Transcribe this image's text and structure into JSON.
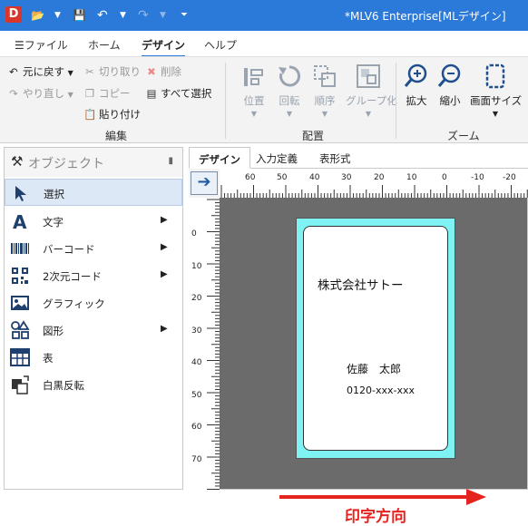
{
  "app": {
    "title": "*MLV6 Enterprise[MLデザイン]",
    "icon_letter": "D"
  },
  "ribbon_tabs": [
    {
      "label": "ファイル",
      "active": false
    },
    {
      "label": "ホーム",
      "active": false
    },
    {
      "label": "デザイン",
      "active": true
    },
    {
      "label": "ヘルプ",
      "active": false
    }
  ],
  "ribbon": {
    "edit": {
      "undo": "元に戻す",
      "redo": "やり直し",
      "cut": "切り取り",
      "copy": "コピー",
      "paste": "貼り付け",
      "delete": "削除",
      "select_all": "すべて選択",
      "group_label": "編集"
    },
    "arrange": {
      "position": "位置",
      "rotate": "回転",
      "order": "順序",
      "group": "グループ化",
      "group_label": "配置"
    },
    "zoom": {
      "zoom_in": "拡大",
      "zoom_out": "縮小",
      "screen_size": "画面サイズ",
      "group_label": "ズーム"
    }
  },
  "objects_panel": {
    "title": "オブジェクト",
    "items": [
      {
        "label": "選択",
        "icon": "cursor-icon",
        "selected": true,
        "has_submenu": false
      },
      {
        "label": "文字",
        "icon": "text-icon",
        "selected": false,
        "has_submenu": true
      },
      {
        "label": "バーコード",
        "icon": "barcode-icon",
        "selected": false,
        "has_submenu": true
      },
      {
        "label": "2次元コード",
        "icon": "qrcode-icon",
        "selected": false,
        "has_submenu": true
      },
      {
        "label": "グラフィック",
        "icon": "image-icon",
        "selected": false,
        "has_submenu": false
      },
      {
        "label": "図形",
        "icon": "shapes-icon",
        "selected": false,
        "has_submenu": true
      },
      {
        "label": "表",
        "icon": "table-icon",
        "selected": false,
        "has_submenu": false
      },
      {
        "label": "白黒反転",
        "icon": "invert-icon",
        "selected": false,
        "has_submenu": false
      }
    ]
  },
  "doc_tabs": [
    {
      "label": "デザイン",
      "active": true
    },
    {
      "label": "入力定義",
      "active": false
    },
    {
      "label": "表形式",
      "active": false
    }
  ],
  "ruler": {
    "horizontal": [
      "60",
      "50",
      "40",
      "30",
      "20",
      "10",
      "0",
      "-10",
      "-20"
    ],
    "vertical": [
      "0",
      "10",
      "20",
      "30",
      "40",
      "50",
      "60",
      "70"
    ]
  },
  "label": {
    "company": "株式会社サトー",
    "name": "佐藤　太郎",
    "phone": "0120-xxx-xxx"
  },
  "print_direction": "印字方向",
  "colors": {
    "titlebar": "#2b79d8",
    "label_bg": "#7ff3f3",
    "canvas_bg": "#6b6b6b",
    "print_direction": "#e52420"
  }
}
